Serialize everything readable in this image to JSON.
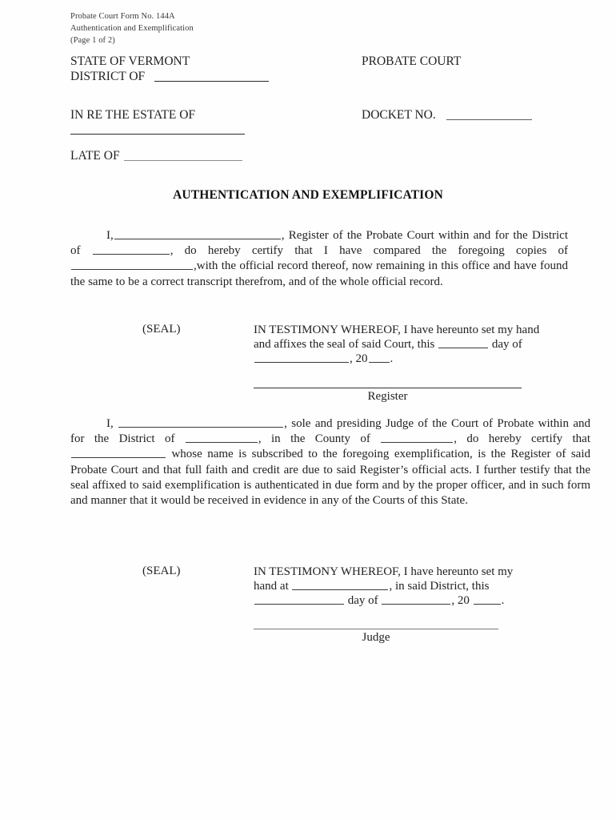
{
  "form_header": {
    "line1": "Probate Court Form No. 144A",
    "line2": "Authentication and Exemplification",
    "line3": "(Page 1 of 2)"
  },
  "caption": {
    "state_label": "STATE OF VERMONT",
    "district_label": "DISTRICT OF",
    "probate_court_label": "PROBATE COURT",
    "in_re_label": "IN RE THE ESTATE OF",
    "docket_label": "DOCKET NO.",
    "late_of_label": "LATE OF",
    "district_value": "",
    "estate_name_value": "",
    "late_of_value": "",
    "docket_no_value": ""
  },
  "title": "AUTHENTICATION AND EXEMPLIFICATION",
  "register_paragraph": {
    "seg1": "I,",
    "seg2": ", Register of the Probate Court within and for the District of",
    "seg3": ", do hereby certify that I have compared the foregoing copies of",
    "seg4": ",with the official record thereof, now remaining in this office and have found the same to be a correct transcript therefrom, and of the whole official record.",
    "register_name_value": "",
    "district_value": "",
    "copies_of_value": ""
  },
  "register_block": {
    "seal_label": "(SEAL)",
    "line1": "IN TESTIMONY WHEREOF, I have hereunto set my hand",
    "line2_a": "and affixes the seal of said Court, this",
    "line2_b": "day of",
    "line3_a": ", 20",
    "line3_b": ".",
    "day_value": "",
    "month_value": "",
    "year_value": "",
    "signature_caption": "Register"
  },
  "judge_paragraph": {
    "seg1": "I,",
    "seg2": ", sole and presiding Judge of the Court of Probate within and for the District of",
    "seg3": ", in the County of",
    "seg4": ", do hereby certify that",
    "seg5": "whose name is subscribed to the foregoing exemplification, is the Register of said Probate Court and that full faith and credit are due to said Register’s official acts.  I further testify that the seal affixed to said exemplification is authenticated in due form and by the proper officer, and in such form and manner that it would be received in evidence in any of the Courts of this State.",
    "judge_name_value": "",
    "district_value": "",
    "county_value": "",
    "subject_name_value": ""
  },
  "judge_block": {
    "seal_label": "(SEAL)",
    "line1": "IN TESTIMONY WHEREOF, I have hereunto set my",
    "line2_a": "hand at",
    "line2_b": ", in said District, this",
    "line3_a": "day of",
    "line3_b": ", 20",
    "line3_c": ".",
    "at_value": "",
    "day_value": "",
    "month_value": "",
    "year_value": "",
    "signature_caption": "Judge"
  },
  "colors": {
    "page_background": "#fefefe",
    "text": "#222222",
    "rule": "#2a2a2a"
  }
}
